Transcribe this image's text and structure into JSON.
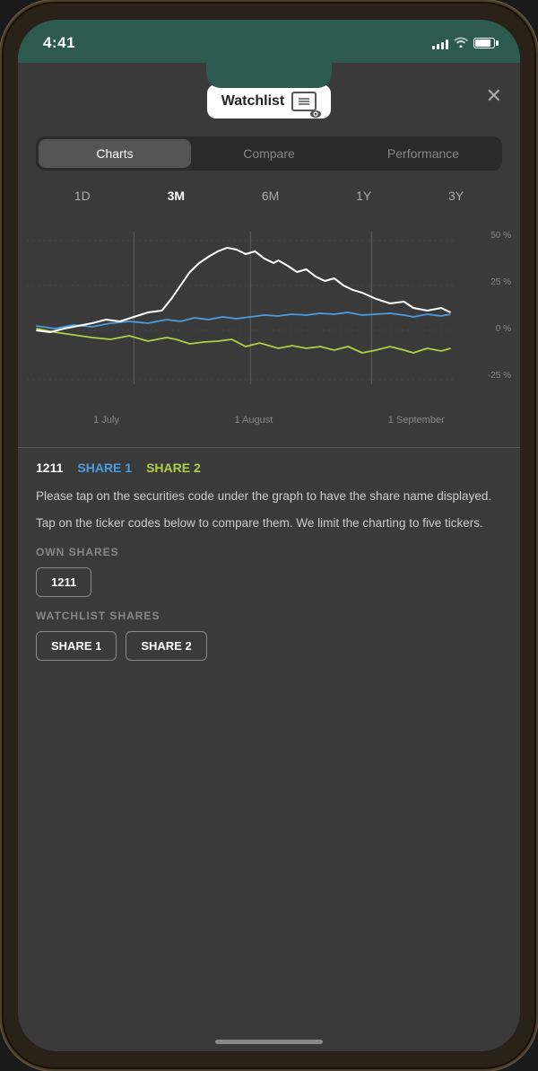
{
  "status": {
    "time": "4:41",
    "signal_bars": [
      4,
      6,
      8,
      10,
      12
    ],
    "battery_percent": 85
  },
  "header": {
    "watchlist_label": "Watchlist",
    "close_label": "✕"
  },
  "tabs": [
    {
      "id": "charts",
      "label": "Charts",
      "active": true
    },
    {
      "id": "compare",
      "label": "Compare",
      "active": false
    },
    {
      "id": "performance",
      "label": "Performance",
      "active": false
    }
  ],
  "chart": {
    "time_periods": [
      {
        "id": "1d",
        "label": "1D"
      },
      {
        "id": "3m",
        "label": "3M",
        "active": true
      },
      {
        "id": "6m",
        "label": "6M"
      },
      {
        "id": "1y",
        "label": "1Y"
      },
      {
        "id": "3y",
        "label": "3Y"
      }
    ],
    "y_labels": [
      "50 %",
      "25 %",
      "0 %",
      "-25 %"
    ],
    "x_labels": [
      "1 July",
      "1 August",
      "1 September"
    ]
  },
  "legend": {
    "items": [
      {
        "id": "1211",
        "label": "1211",
        "color": "white"
      },
      {
        "id": "share1",
        "label": "SHARE 1",
        "color": "#4a9de0"
      },
      {
        "id": "share2",
        "label": "SHARE 2",
        "color": "#b0d044"
      }
    ]
  },
  "info": {
    "line1": "Please tap on the securities code under the graph to have the share name displayed.",
    "line2": "Tap on the ticker codes below to compare them. We limit the charting to five tickers."
  },
  "own_shares": {
    "label": "OWN SHARES",
    "chips": [
      {
        "label": "1211"
      }
    ]
  },
  "watchlist_shares": {
    "label": "WATCHLIST SHARES",
    "chips": [
      {
        "label": "SHARE 1"
      },
      {
        "label": "SHARE 2"
      }
    ]
  }
}
